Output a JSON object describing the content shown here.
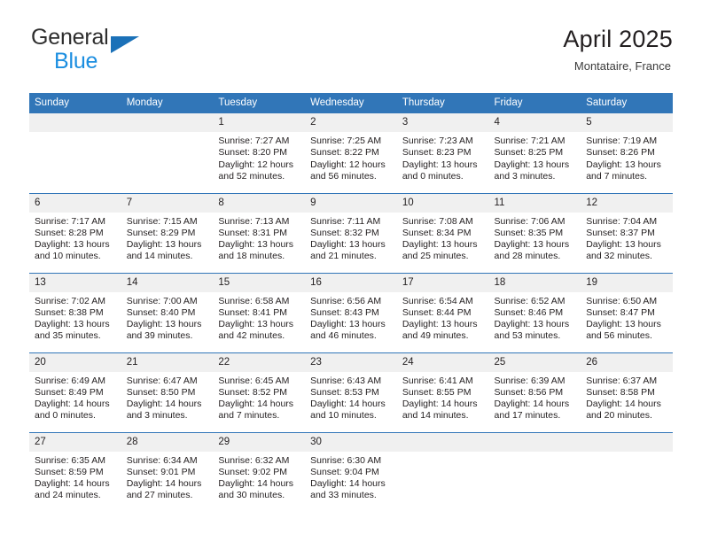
{
  "brand": {
    "name_top": "General",
    "name_bottom": "Blue",
    "triangle_color": "#1b71b8",
    "top_color": "#2e2e2e",
    "bottom_color": "#1b8ee0"
  },
  "header": {
    "title": "April 2025",
    "subtitle": "Montataire, France"
  },
  "theme": {
    "header_blue": "#3176b8",
    "date_band": "#f0f0f0",
    "text": "#231f20"
  },
  "weekday_headers": [
    "Sunday",
    "Monday",
    "Tuesday",
    "Wednesday",
    "Thursday",
    "Friday",
    "Saturday"
  ],
  "labels": {
    "sunrise": "Sunrise:",
    "sunset": "Sunset:",
    "daylight": "Daylight:"
  },
  "weeks": [
    [
      {
        "day": "",
        "sunrise": "",
        "sunset": "",
        "daylight": ""
      },
      {
        "day": "",
        "sunrise": "",
        "sunset": "",
        "daylight": ""
      },
      {
        "day": "1",
        "sunrise": "Sunrise: 7:27 AM",
        "sunset": "Sunset: 8:20 PM",
        "daylight": "Daylight: 12 hours and 52 minutes."
      },
      {
        "day": "2",
        "sunrise": "Sunrise: 7:25 AM",
        "sunset": "Sunset: 8:22 PM",
        "daylight": "Daylight: 12 hours and 56 minutes."
      },
      {
        "day": "3",
        "sunrise": "Sunrise: 7:23 AM",
        "sunset": "Sunset: 8:23 PM",
        "daylight": "Daylight: 13 hours and 0 minutes."
      },
      {
        "day": "4",
        "sunrise": "Sunrise: 7:21 AM",
        "sunset": "Sunset: 8:25 PM",
        "daylight": "Daylight: 13 hours and 3 minutes."
      },
      {
        "day": "5",
        "sunrise": "Sunrise: 7:19 AM",
        "sunset": "Sunset: 8:26 PM",
        "daylight": "Daylight: 13 hours and 7 minutes."
      }
    ],
    [
      {
        "day": "6",
        "sunrise": "Sunrise: 7:17 AM",
        "sunset": "Sunset: 8:28 PM",
        "daylight": "Daylight: 13 hours and 10 minutes."
      },
      {
        "day": "7",
        "sunrise": "Sunrise: 7:15 AM",
        "sunset": "Sunset: 8:29 PM",
        "daylight": "Daylight: 13 hours and 14 minutes."
      },
      {
        "day": "8",
        "sunrise": "Sunrise: 7:13 AM",
        "sunset": "Sunset: 8:31 PM",
        "daylight": "Daylight: 13 hours and 18 minutes."
      },
      {
        "day": "9",
        "sunrise": "Sunrise: 7:11 AM",
        "sunset": "Sunset: 8:32 PM",
        "daylight": "Daylight: 13 hours and 21 minutes."
      },
      {
        "day": "10",
        "sunrise": "Sunrise: 7:08 AM",
        "sunset": "Sunset: 8:34 PM",
        "daylight": "Daylight: 13 hours and 25 minutes."
      },
      {
        "day": "11",
        "sunrise": "Sunrise: 7:06 AM",
        "sunset": "Sunset: 8:35 PM",
        "daylight": "Daylight: 13 hours and 28 minutes."
      },
      {
        "day": "12",
        "sunrise": "Sunrise: 7:04 AM",
        "sunset": "Sunset: 8:37 PM",
        "daylight": "Daylight: 13 hours and 32 minutes."
      }
    ],
    [
      {
        "day": "13",
        "sunrise": "Sunrise: 7:02 AM",
        "sunset": "Sunset: 8:38 PM",
        "daylight": "Daylight: 13 hours and 35 minutes."
      },
      {
        "day": "14",
        "sunrise": "Sunrise: 7:00 AM",
        "sunset": "Sunset: 8:40 PM",
        "daylight": "Daylight: 13 hours and 39 minutes."
      },
      {
        "day": "15",
        "sunrise": "Sunrise: 6:58 AM",
        "sunset": "Sunset: 8:41 PM",
        "daylight": "Daylight: 13 hours and 42 minutes."
      },
      {
        "day": "16",
        "sunrise": "Sunrise: 6:56 AM",
        "sunset": "Sunset: 8:43 PM",
        "daylight": "Daylight: 13 hours and 46 minutes."
      },
      {
        "day": "17",
        "sunrise": "Sunrise: 6:54 AM",
        "sunset": "Sunset: 8:44 PM",
        "daylight": "Daylight: 13 hours and 49 minutes."
      },
      {
        "day": "18",
        "sunrise": "Sunrise: 6:52 AM",
        "sunset": "Sunset: 8:46 PM",
        "daylight": "Daylight: 13 hours and 53 minutes."
      },
      {
        "day": "19",
        "sunrise": "Sunrise: 6:50 AM",
        "sunset": "Sunset: 8:47 PM",
        "daylight": "Daylight: 13 hours and 56 minutes."
      }
    ],
    [
      {
        "day": "20",
        "sunrise": "Sunrise: 6:49 AM",
        "sunset": "Sunset: 8:49 PM",
        "daylight": "Daylight: 14 hours and 0 minutes."
      },
      {
        "day": "21",
        "sunrise": "Sunrise: 6:47 AM",
        "sunset": "Sunset: 8:50 PM",
        "daylight": "Daylight: 14 hours and 3 minutes."
      },
      {
        "day": "22",
        "sunrise": "Sunrise: 6:45 AM",
        "sunset": "Sunset: 8:52 PM",
        "daylight": "Daylight: 14 hours and 7 minutes."
      },
      {
        "day": "23",
        "sunrise": "Sunrise: 6:43 AM",
        "sunset": "Sunset: 8:53 PM",
        "daylight": "Daylight: 14 hours and 10 minutes."
      },
      {
        "day": "24",
        "sunrise": "Sunrise: 6:41 AM",
        "sunset": "Sunset: 8:55 PM",
        "daylight": "Daylight: 14 hours and 14 minutes."
      },
      {
        "day": "25",
        "sunrise": "Sunrise: 6:39 AM",
        "sunset": "Sunset: 8:56 PM",
        "daylight": "Daylight: 14 hours and 17 minutes."
      },
      {
        "day": "26",
        "sunrise": "Sunrise: 6:37 AM",
        "sunset": "Sunset: 8:58 PM",
        "daylight": "Daylight: 14 hours and 20 minutes."
      }
    ],
    [
      {
        "day": "27",
        "sunrise": "Sunrise: 6:35 AM",
        "sunset": "Sunset: 8:59 PM",
        "daylight": "Daylight: 14 hours and 24 minutes."
      },
      {
        "day": "28",
        "sunrise": "Sunrise: 6:34 AM",
        "sunset": "Sunset: 9:01 PM",
        "daylight": "Daylight: 14 hours and 27 minutes."
      },
      {
        "day": "29",
        "sunrise": "Sunrise: 6:32 AM",
        "sunset": "Sunset: 9:02 PM",
        "daylight": "Daylight: 14 hours and 30 minutes."
      },
      {
        "day": "30",
        "sunrise": "Sunrise: 6:30 AM",
        "sunset": "Sunset: 9:04 PM",
        "daylight": "Daylight: 14 hours and 33 minutes."
      },
      {
        "day": "",
        "sunrise": "",
        "sunset": "",
        "daylight": ""
      },
      {
        "day": "",
        "sunrise": "",
        "sunset": "",
        "daylight": ""
      },
      {
        "day": "",
        "sunrise": "",
        "sunset": "",
        "daylight": ""
      }
    ]
  ]
}
